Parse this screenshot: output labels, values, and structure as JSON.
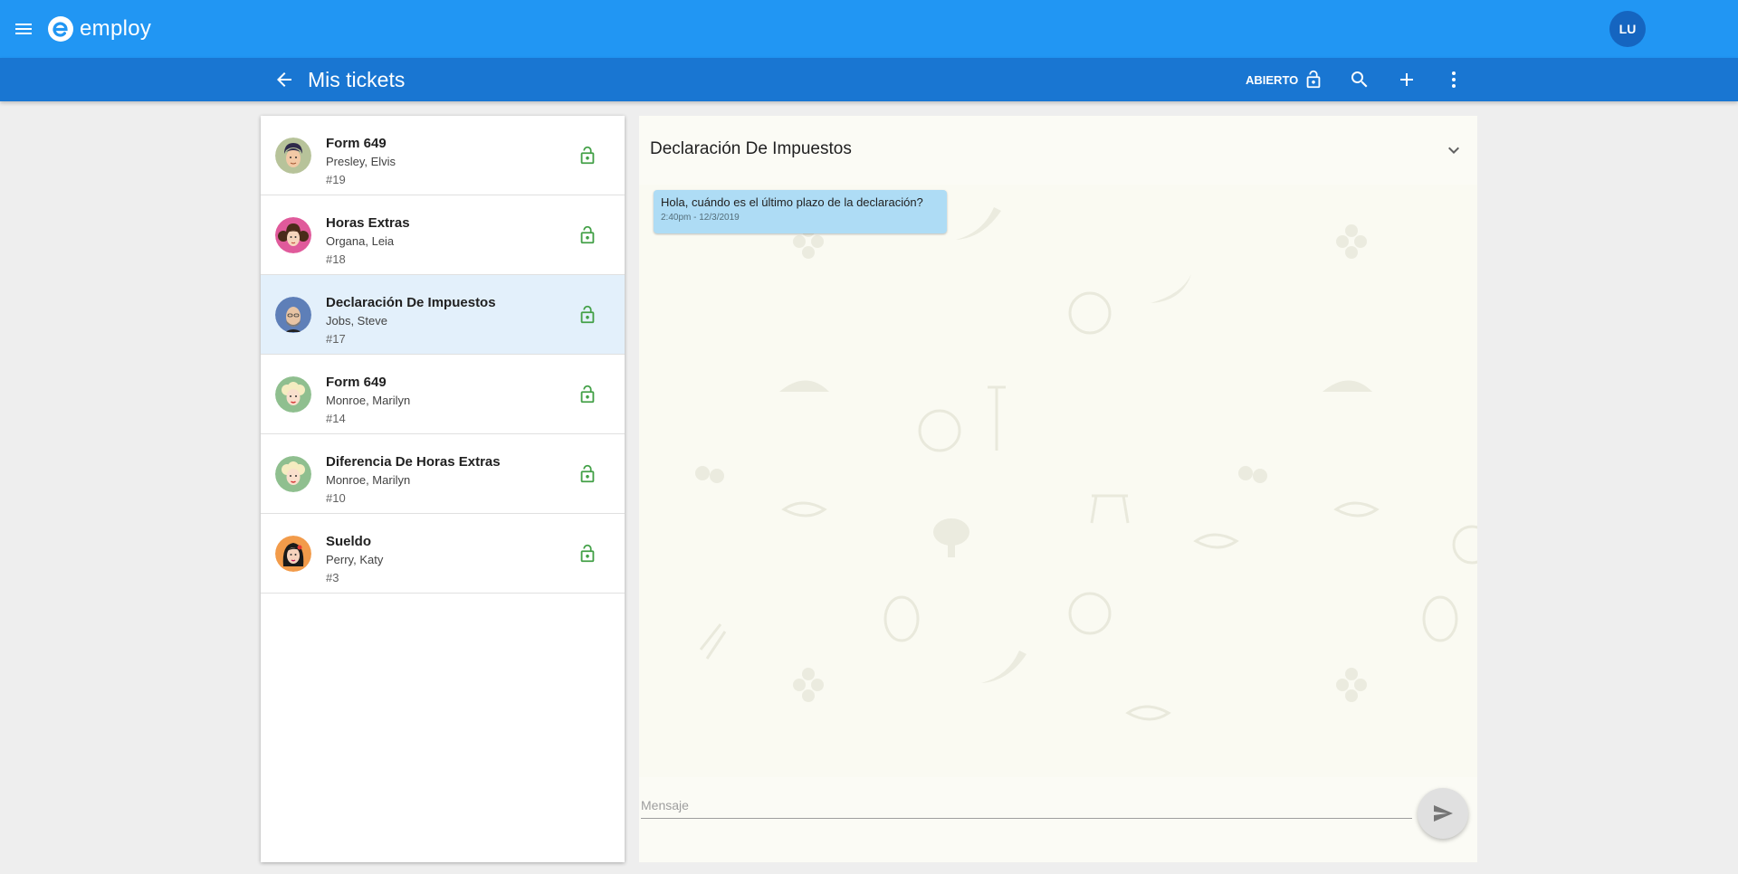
{
  "app": {
    "brand": "employ",
    "user_initials": "LU"
  },
  "header": {
    "title": "Mis tickets",
    "status_filter": "ABIERTO"
  },
  "colors": {
    "primary": "#2196f3",
    "primary_dark": "#1976d2",
    "lock_green": "#43a047",
    "bubble": "#aedcf5"
  },
  "tickets": [
    {
      "title": "Form 649",
      "name": "Presley, Elvis",
      "number": "#19",
      "avatar": "elvis",
      "status_icon": "lock-open-icon"
    },
    {
      "title": "Horas Extras",
      "name": "Organa, Leia",
      "number": "#18",
      "avatar": "leia",
      "status_icon": "lock-open-icon"
    },
    {
      "title": "Declaración De Impuestos",
      "name": "Jobs, Steve",
      "number": "#17",
      "avatar": "steve",
      "status_icon": "lock-open-icon"
    },
    {
      "title": "Form 649",
      "name": "Monroe, Marilyn",
      "number": "#14",
      "avatar": "marilyn",
      "status_icon": "lock-open-icon"
    },
    {
      "title": "Diferencia De Horas Extras",
      "name": "Monroe, Marilyn",
      "number": "#10",
      "avatar": "marilyn",
      "status_icon": "lock-open-icon"
    },
    {
      "title": "Sueldo",
      "name": "Perry, Katy",
      "number": "#3",
      "avatar": "katy",
      "status_icon": "lock-open-icon"
    }
  ],
  "selected_ticket": 2,
  "chat": {
    "title": "Declaración De Impuestos",
    "messages": [
      {
        "text": "Hola, cuándo es el último plazo de la declaración?",
        "time": "2:40pm - 12/3/2019"
      }
    ],
    "input_placeholder": "Mensaje",
    "input_value": ""
  }
}
